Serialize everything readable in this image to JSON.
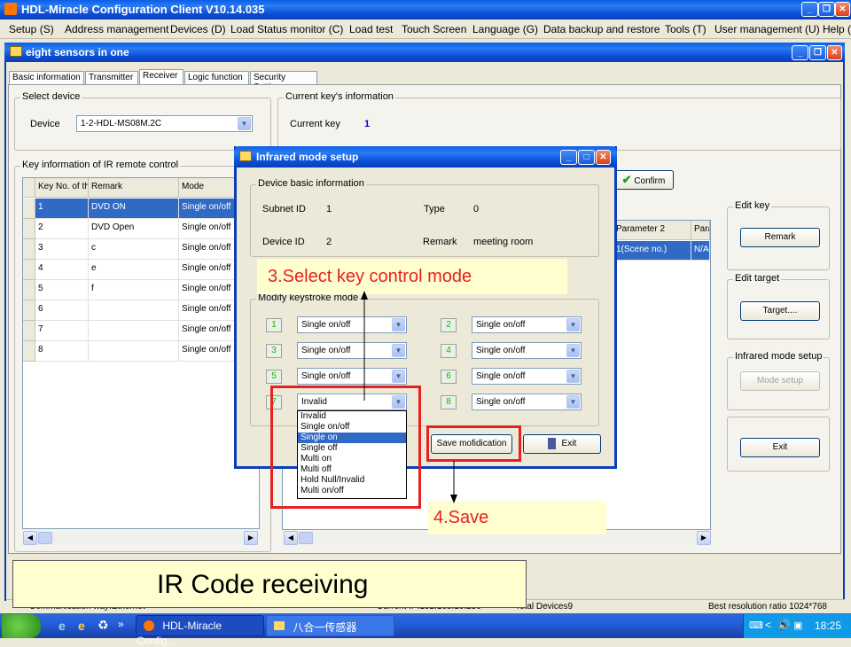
{
  "app": {
    "title": "HDL-Miracle Configuration Client V10.14.035",
    "menu": [
      "Setup (S)",
      "Address management",
      "Devices (D)",
      "Load Status monitor (C)",
      "Load test",
      "Touch Screen",
      "Language (G)",
      "Data backup and restore",
      "Tools (T)",
      "User management (U)",
      "Help ("
    ]
  },
  "child": {
    "title": "eight sensors in one",
    "tabs": [
      "Basic information",
      "Transmitter",
      "Receiver",
      "Logic function",
      "Security Setting"
    ],
    "select_device": {
      "label": "Select device",
      "device_label": "Device",
      "device_value": "1-2-HDL-MS08M.2C"
    },
    "current_key": {
      "label": "Current key's information",
      "key_label": "Current key",
      "key_value": "1"
    },
    "key_info": {
      "label": "Key information of IR remote control",
      "columns": [
        "Key No. of th",
        "Remark",
        "Mode"
      ],
      "rows": [
        [
          "1",
          "DVD ON",
          "Single on/off"
        ],
        [
          "2",
          "DVD Open",
          "Single on/off"
        ],
        [
          "3",
          "c",
          "Single on/off"
        ],
        [
          "4",
          "e",
          "Single on/off"
        ],
        [
          "5",
          "f",
          "Single on/off"
        ],
        [
          "6",
          "",
          "Single on/off"
        ],
        [
          "7",
          "",
          "Single on/off"
        ],
        [
          "8",
          "",
          "Single on/off"
        ]
      ]
    },
    "confirm_label": "Confirm",
    "right_grid": {
      "columns": [
        "Parameter 2",
        "Para"
      ],
      "row": [
        "1(Scene no.)",
        "N/A"
      ]
    },
    "edit_key": {
      "label": "Edit key",
      "button": "Remark"
    },
    "edit_target": {
      "label": "Edit target",
      "button": "Target...."
    },
    "ir_setup": {
      "label": "Infrared mode setup",
      "button": "Mode setup"
    },
    "exit_label": "Exit"
  },
  "dialog": {
    "title": "Infrared mode setup",
    "device_info": {
      "label": "Device basic information",
      "subnet_label": "Subnet ID",
      "subnet_value": "1",
      "type_label": "Type",
      "type_value": "0",
      "device_label": "Device ID",
      "device_value": "2",
      "remark_label": "Remark",
      "remark_value": "meeting room"
    },
    "modify_label": "Modify keystroke mode",
    "keys": [
      {
        "num": "1",
        "mode": "Single on/off"
      },
      {
        "num": "2",
        "mode": "Single on/off"
      },
      {
        "num": "3",
        "mode": "Single on/off"
      },
      {
        "num": "4",
        "mode": "Single on/off"
      },
      {
        "num": "5",
        "mode": "Single on/off"
      },
      {
        "num": "6",
        "mode": "Single on/off"
      },
      {
        "num": "7",
        "mode": "Invalid"
      },
      {
        "num": "8",
        "mode": "Single on/off"
      }
    ],
    "dropdown_options": [
      "Invalid",
      "Single on/off",
      "Single on",
      "Single off",
      "Multi on",
      "Multi off",
      "Hold Null/Invalid",
      "Multi on/off"
    ],
    "dropdown_selected": "Single on",
    "save_label": "Save mofidication",
    "exit_label": "Exit"
  },
  "status": {
    "comm": "Communication way:Ethernet",
    "ip": "Current IP:192.168.10.250",
    "total": "Total Devices9",
    "resolution": "Best resolution ratio  1024*768"
  },
  "taskbar": {
    "items": [
      "HDL-Miracle Config...",
      "八合一传感器"
    ],
    "clock": "18:25"
  },
  "annotations": {
    "step3": "3.Select key control mode",
    "step4": "4.Save",
    "bottom": "IR Code receiving"
  },
  "colors": {
    "highlight": "#e82020",
    "callout_bg": "#fefece",
    "selection": "#316ac5"
  }
}
